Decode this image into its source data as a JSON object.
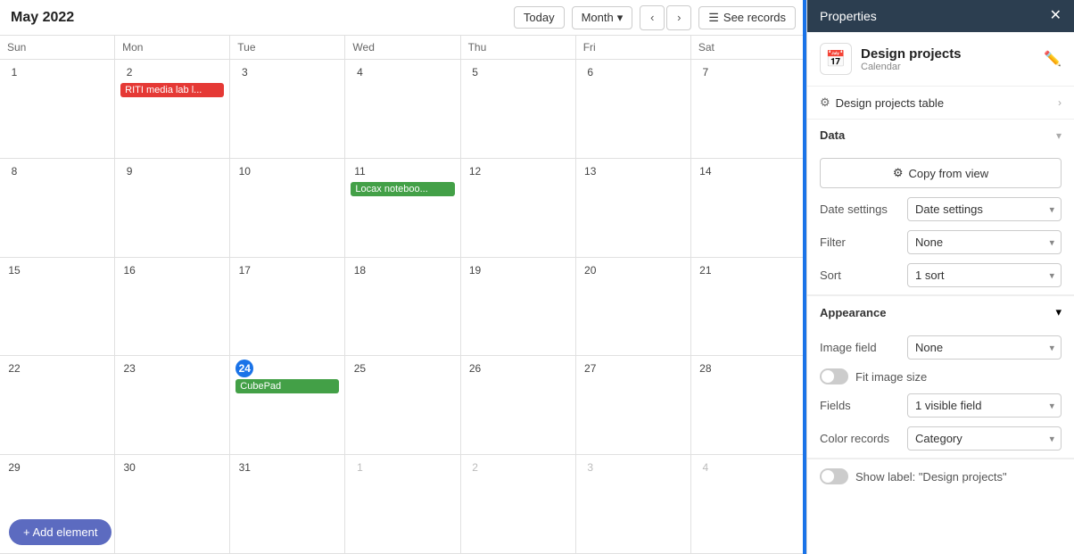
{
  "calendar": {
    "title": "May 2022",
    "today_label": "Today",
    "month_label": "Month",
    "see_records_label": "See records",
    "day_names": [
      "Sun",
      "Mon",
      "Tue",
      "Wed",
      "Thu",
      "Fri",
      "Sat"
    ],
    "weeks": [
      [
        {
          "num": "1",
          "other": false,
          "today": false,
          "events": []
        },
        {
          "num": "2",
          "other": false,
          "today": false,
          "events": [
            {
              "label": "RITI media lab l...",
              "color": "red"
            }
          ]
        },
        {
          "num": "3",
          "other": false,
          "today": false,
          "events": []
        },
        {
          "num": "4",
          "other": false,
          "today": false,
          "events": []
        },
        {
          "num": "5",
          "other": false,
          "today": false,
          "events": []
        },
        {
          "num": "6",
          "other": false,
          "today": false,
          "events": []
        },
        {
          "num": "7",
          "other": false,
          "today": false,
          "events": []
        }
      ],
      [
        {
          "num": "8",
          "other": false,
          "today": false,
          "events": []
        },
        {
          "num": "9",
          "other": false,
          "today": false,
          "events": []
        },
        {
          "num": "10",
          "other": false,
          "today": false,
          "events": []
        },
        {
          "num": "11",
          "other": false,
          "today": false,
          "events": [
            {
              "label": "Locax noteboo...",
              "color": "green"
            }
          ]
        },
        {
          "num": "12",
          "other": false,
          "today": false,
          "events": []
        },
        {
          "num": "13",
          "other": false,
          "today": false,
          "events": []
        },
        {
          "num": "14",
          "other": false,
          "today": false,
          "events": []
        }
      ],
      [
        {
          "num": "15",
          "other": false,
          "today": false,
          "events": []
        },
        {
          "num": "16",
          "other": false,
          "today": false,
          "events": []
        },
        {
          "num": "17",
          "other": false,
          "today": false,
          "events": []
        },
        {
          "num": "18",
          "other": false,
          "today": false,
          "events": []
        },
        {
          "num": "19",
          "other": false,
          "today": false,
          "events": []
        },
        {
          "num": "20",
          "other": false,
          "today": false,
          "events": []
        },
        {
          "num": "21",
          "other": false,
          "today": false,
          "events": []
        }
      ],
      [
        {
          "num": "22",
          "other": false,
          "today": false,
          "events": []
        },
        {
          "num": "23",
          "other": false,
          "today": false,
          "events": []
        },
        {
          "num": "24",
          "other": false,
          "today": true,
          "events": [
            {
              "label": "CubePad",
              "color": "green"
            }
          ]
        },
        {
          "num": "25",
          "other": false,
          "today": false,
          "events": []
        },
        {
          "num": "26",
          "other": false,
          "today": false,
          "events": []
        },
        {
          "num": "27",
          "other": false,
          "today": false,
          "events": []
        },
        {
          "num": "28",
          "other": false,
          "today": false,
          "events": []
        }
      ],
      [
        {
          "num": "29",
          "other": false,
          "today": false,
          "events": []
        },
        {
          "num": "30",
          "other": false,
          "today": false,
          "events": []
        },
        {
          "num": "31",
          "other": false,
          "today": false,
          "events": []
        },
        {
          "num": "1",
          "other": true,
          "today": false,
          "events": []
        },
        {
          "num": "2",
          "other": true,
          "today": false,
          "events": []
        },
        {
          "num": "3",
          "other": true,
          "today": false,
          "events": []
        },
        {
          "num": "4",
          "other": true,
          "today": false,
          "events": []
        }
      ]
    ],
    "add_element_label": "+ Add element"
  },
  "properties": {
    "panel_title": "Properties",
    "app_name": "Design projects",
    "app_type": "Calendar",
    "table_label": "Design projects table",
    "data_label": "Data",
    "copy_from_label": "Copy from view",
    "date_settings_label": "Date settings",
    "date_settings_value": "Date settings",
    "filter_label": "Filter",
    "filter_value": "None",
    "sort_label": "Sort",
    "sort_value": "1 sort",
    "appearance_label": "Appearance",
    "image_field_label": "Image field",
    "image_field_value": "None",
    "fit_image_label": "Fit image size",
    "fields_label": "Fields",
    "fields_value": "1 visible field",
    "color_records_label": "Color records",
    "color_records_value": "Category",
    "show_label_text": "Show label: \"Design projects\""
  }
}
